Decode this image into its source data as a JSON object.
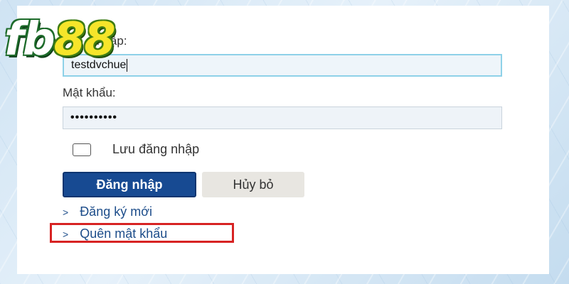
{
  "logo": {
    "part1": "fb",
    "part2": "88"
  },
  "form": {
    "username_label": "nhập:",
    "username_value": "testdvchue",
    "password_label": "Mật khẩu:",
    "password_value": "••••••••••",
    "remember_label": "Lưu đăng nhập",
    "remember_checked": false,
    "login_button": "Đăng nhập",
    "cancel_button": "Hủy bỏ"
  },
  "links": {
    "chevron": ">",
    "register": "Đăng ký mới",
    "forgot_password": "Quên mật khẩu"
  },
  "colors": {
    "login_button_bg": "#174a92",
    "link_color": "#1d4d8a",
    "highlight_border": "#d72323"
  }
}
